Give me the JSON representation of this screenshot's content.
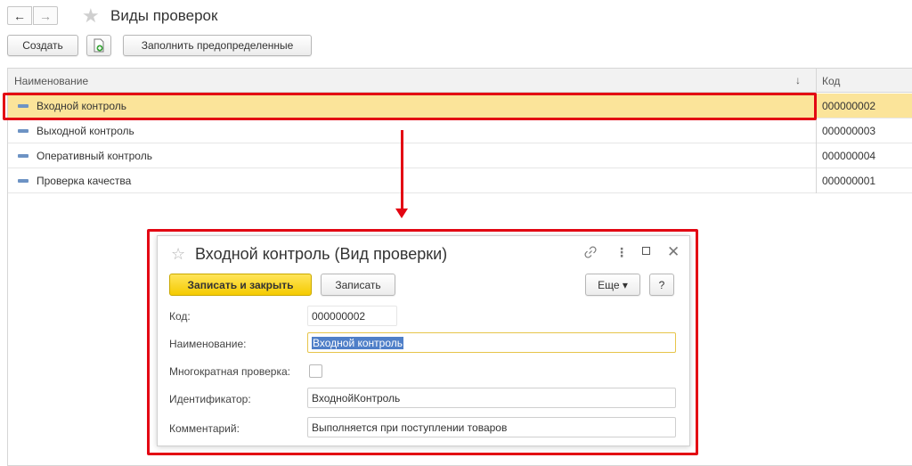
{
  "header": {
    "title": "Виды проверок",
    "back_icon": "←",
    "forward_icon": "→",
    "star_icon": "★"
  },
  "toolbar": {
    "create_label": "Создать",
    "add_file_icon": "+",
    "fill_predefined_label": "Заполнить предопределенные"
  },
  "list": {
    "columns": {
      "name": "Наименование",
      "code": "Код",
      "sort_icon": "↓"
    },
    "rows": [
      {
        "name": "Входной контроль",
        "code": "000000002",
        "selected": true
      },
      {
        "name": "Выходной контроль",
        "code": "000000003",
        "selected": false
      },
      {
        "name": "Оперативный контроль",
        "code": "000000004",
        "selected": false
      },
      {
        "name": "Проверка качества",
        "code": "000000001",
        "selected": false
      }
    ]
  },
  "dialog": {
    "title": "Входной контроль (Вид проверки)",
    "star_icon": "☆",
    "link_icon": "🔗",
    "more_icon": "⋮",
    "close_icon": "✕",
    "save_close_label": "Записать и закрыть",
    "save_label": "Записать",
    "more_label": "Еще ▾",
    "help_label": "?",
    "fields": {
      "code_label": "Код:",
      "code_value": "000000002",
      "name_label": "Наименование:",
      "name_value": "Входной контроль",
      "multiple_label": "Многократная проверка:",
      "identifier_label": "Идентификатор:",
      "identifier_value": "ВходнойКонтроль",
      "comment_label": "Комментарий:",
      "comment_value": "Выполняется при поступлении товаров"
    }
  },
  "colors": {
    "selected_row": "#fbe49a",
    "highlight_frame": "#e30613",
    "primary_button": "#f5cb00",
    "text_selection": "#4f7fc8"
  }
}
